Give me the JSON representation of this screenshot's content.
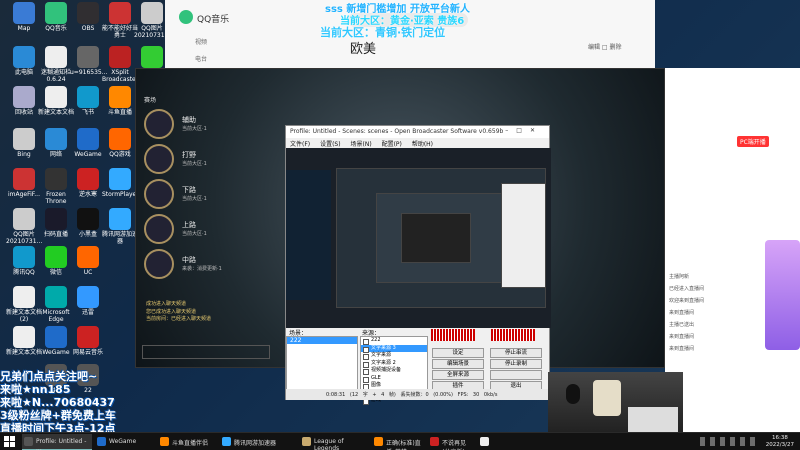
{
  "desktop": {
    "icons": [
      {
        "label": "Map",
        "color": "#3a7bd5"
      },
      {
        "label": "QQ音乐",
        "color": "#31c27c"
      },
      {
        "label": "OBS",
        "color": "#302e31"
      },
      {
        "label": "能不能好好当勇士",
        "color": "#c33"
      },
      {
        "label": "QQ图片20210731...",
        "color": "#ccc"
      },
      {
        "label": "此电脑",
        "color": "#2a8ad6"
      },
      {
        "label": "迷糊通知栏 0.6.24",
        "color": "#eee"
      },
      {
        "label": "u=916535...",
        "color": "#666"
      },
      {
        "label": "XSplit Broadcaster",
        "color": "#b22"
      },
      {
        "label": "7.1 Summo...",
        "color": "#3c3"
      },
      {
        "label": "回收站",
        "color": "#aac"
      },
      {
        "label": "新建文本文档",
        "color": "#eee"
      },
      {
        "label": "飞书",
        "color": "#19c"
      },
      {
        "label": "斗鱼直播",
        "color": "#f80"
      },
      {
        "label": "Bing",
        "color": "#ccc"
      },
      {
        "label": "网络",
        "color": "#2a8ad6"
      },
      {
        "label": "WeGame",
        "color": "#1f6bc9"
      },
      {
        "label": "QQ游戏",
        "color": "#f60"
      },
      {
        "label": "imAgeFiF...",
        "color": "#c33"
      },
      {
        "label": "Frozen Throne",
        "color": "#333"
      },
      {
        "label": "逆水寒",
        "color": "#c22"
      },
      {
        "label": "StormPlayer",
        "color": "#3af"
      },
      {
        "label": "QQ图片20210731...",
        "color": "#ccc"
      },
      {
        "label": "扫码直播",
        "color": "#1a1a2a"
      },
      {
        "label": "小黑盒",
        "color": "#111"
      },
      {
        "label": "腾讯网游加速器",
        "color": "#3af"
      },
      {
        "label": "腾讯QQ",
        "color": "#19c"
      },
      {
        "label": "微信",
        "color": "#2c2"
      },
      {
        "label": "UC",
        "color": "#f60"
      },
      {
        "label": "新建文本文档 (2)",
        "color": "#eee"
      },
      {
        "label": "Microsoft Edge",
        "color": "#0aa"
      },
      {
        "label": "迅雷",
        "color": "#39f"
      },
      {
        "label": "新建文本文档",
        "color": "#eee"
      },
      {
        "label": "WeGame",
        "color": "#1f6bc9"
      },
      {
        "label": "网易云音乐",
        "color": "#c22"
      },
      {
        "label": "41",
        "color": "#555"
      },
      {
        "label": "22",
        "color": "#555"
      }
    ]
  },
  "qqmusic": {
    "brand": "QQ音乐",
    "nav": [
      "视频",
      "电台"
    ],
    "title": "欧美",
    "actions": "编辑   □ 删除"
  },
  "overlay_top": [
    "sss 新增门槛增加 开放平台新人",
    "当前大区：黄金·亚索 贵族6",
    "当前大区：青铜·铁门定位"
  ],
  "game": {
    "context": "赛场",
    "skills": [
      {
        "name": "辅助",
        "sub": "当前大区·1"
      },
      {
        "name": "打野",
        "sub": "当前大区·1"
      },
      {
        "name": "下路",
        "sub": "当前大区·1"
      },
      {
        "name": "上路",
        "sub": "当前大区·1"
      },
      {
        "name": "中路",
        "sub": "来袭：消费更新·1"
      }
    ],
    "chat": [
      "成功进入聊天频道",
      "您已成功进入聊天频道",
      "当前房间：已经进入聊天频道"
    ]
  },
  "obs": {
    "title": "Profile: Untitled - Scenes: scenes - Open Broadcaster Software v0.659b",
    "menu": [
      "文件(F)",
      "设置(S)",
      "场景(N)",
      "配置(P)",
      "帮助(H)"
    ],
    "scenes_label": "场景：",
    "sources_label": "来源：",
    "scene": "222",
    "sources": [
      "222",
      "文字来源 3",
      "文字来源",
      "文字来源 2",
      "视频捕捉设备",
      "GLE",
      "图像",
      "GLE 2",
      "游戏"
    ],
    "buttons": [
      "设定",
      "停止串流",
      "编辑场景",
      "停止录制",
      "全屏来源",
      "",
      "插件",
      "退出"
    ],
    "status": "0:08:31   (12 字 + 4 帧)   丢失帧数：0 (0.00%)   FPS: 30   0kb/s"
  },
  "overlay_bottom": [
    "兄弟们点点关注吧~",
    "来啦★nn185",
    "来啦★N...70680437",
    "3级粉丝牌+群免费上车",
    "直播时间下午3点-12点"
  ],
  "browser": {
    "pc_live": "PC端开播",
    "lines": [
      "主播阿新",
      "已经进入直播间",
      "欢迎来到直播间",
      "来到直播间",
      "主播已送出",
      "来到直播间",
      "来到直播间"
    ]
  },
  "taskbar": {
    "items": [
      {
        "label": "Profile: Untitled - ...",
        "color": "#555",
        "active": true
      },
      {
        "label": "WeGame",
        "color": "#1f6bc9",
        "active": false
      },
      {
        "label": "斗鱼直播伴侣",
        "color": "#f80",
        "active": false
      },
      {
        "label": "腾讯网游加速器",
        "color": "#3af",
        "active": false
      },
      {
        "label": "League of Legends",
        "color": "#c8aa6e",
        "active": false
      },
      {
        "label": "正确(标准)直播_英雄...",
        "color": "#f80",
        "active": false
      },
      {
        "label": "不说再见 (分享版)",
        "color": "#c22",
        "active": false
      },
      {
        "label": "",
        "color": "#eee",
        "active": false
      }
    ],
    "time": "16:38",
    "date": "2022/3/27"
  },
  "colors": {
    "obs_select": "#3399ff",
    "overlay_text": "#22b3ff"
  }
}
